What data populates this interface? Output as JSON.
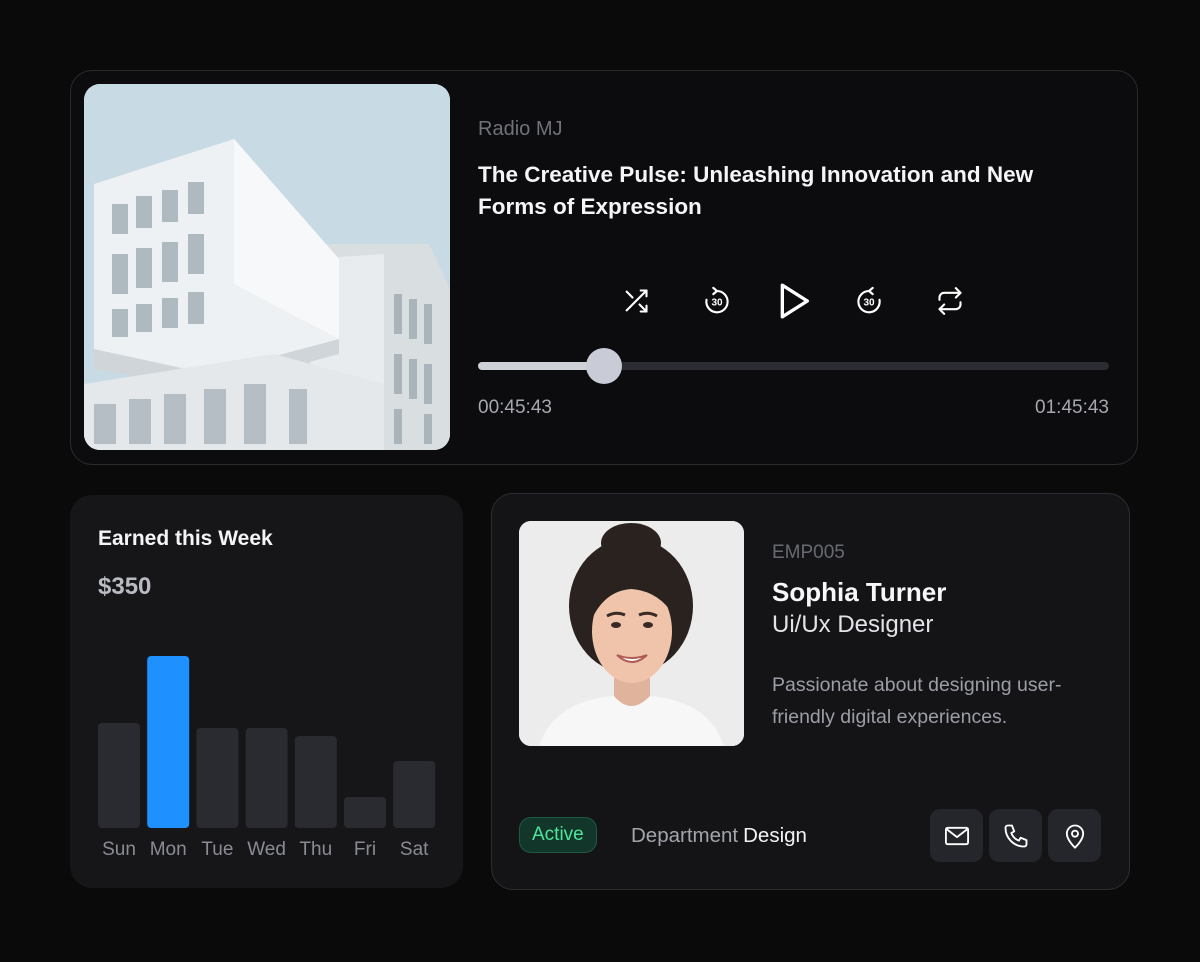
{
  "player": {
    "station": "Radio MJ",
    "title": "The Creative Pulse: Unleashing Innovation and New Forms of Expression",
    "current_time": "00:45:43",
    "total_time": "01:45:43",
    "progress": 0.2,
    "controls": {
      "shuffle_icon": "shuffle-icon",
      "rewind_icon": "rewind-30-icon",
      "rewind_label": "30",
      "play_icon": "play-icon",
      "forward_icon": "forward-30-icon",
      "forward_label": "30",
      "repeat_icon": "repeat-icon"
    }
  },
  "earnings": {
    "title": "Earned this Week",
    "amount": "$350"
  },
  "chart_data": {
    "type": "bar",
    "categories": [
      "Sun",
      "Mon",
      "Tue",
      "Wed",
      "Thu",
      "Fri",
      "Sat"
    ],
    "values": [
      105,
      172,
      100,
      100,
      92,
      31,
      67
    ],
    "highlight_index": 1,
    "highlight_color": "#1e90ff",
    "bar_color": "#2a2b30",
    "ylim": [
      0,
      172
    ],
    "grid": false
  },
  "profile": {
    "emp_id": "EMP005",
    "name": "Sophia Turner",
    "role": "Ui/Ux Designer",
    "bio": "Passionate about designing user-friendly digital experiences.",
    "status": "Active",
    "status_color": "#4ee49a",
    "department_label": "Department",
    "department": "Design",
    "actions": [
      "mail-icon",
      "phone-icon",
      "location-pin-icon"
    ]
  }
}
